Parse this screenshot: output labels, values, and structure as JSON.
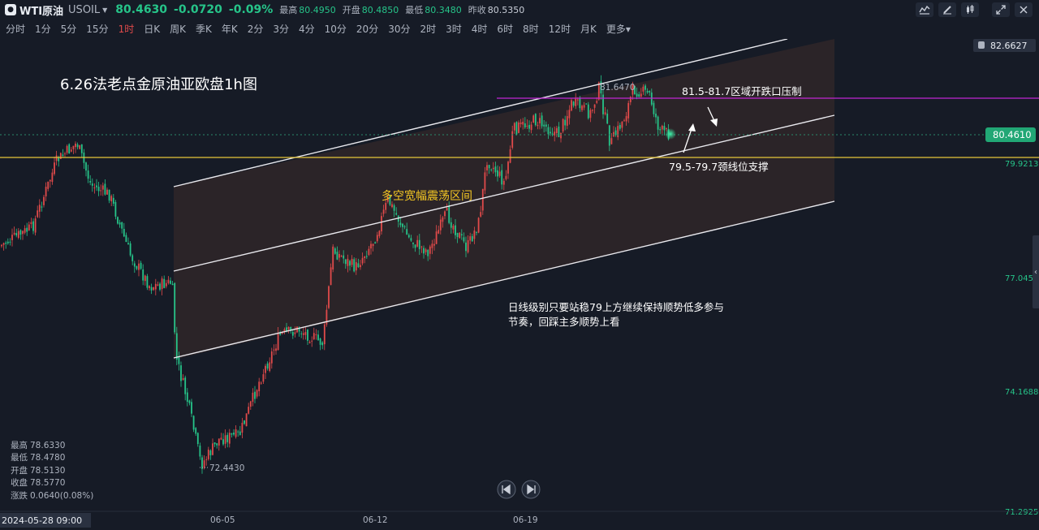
{
  "header": {
    "symbol": "WTI原油",
    "code": "USOIL",
    "price": "80.4630",
    "change": "-0.0720",
    "change_pct": "-0.09%",
    "high_label": "最高",
    "high": "80.4950",
    "open_label": "开盘",
    "open": "80.4850",
    "low_label": "最低",
    "low": "80.3480",
    "prev_label": "昨收",
    "prev": "80.5350",
    "price_color": "#26c489"
  },
  "timeframes": [
    "分时",
    "1分",
    "5分",
    "15分",
    "1时",
    "日K",
    "周K",
    "季K",
    "年K",
    "2分",
    "3分",
    "4分",
    "10分",
    "20分",
    "30分",
    "2时",
    "3时",
    "4时",
    "6时",
    "8时",
    "12时",
    "月K",
    "更多"
  ],
  "active_timeframe": "1时",
  "price_axis": {
    "labels": [
      "82.6627",
      "79.9213",
      "77.0450",
      "74.1688",
      "71.2925"
    ],
    "current": "80.4610"
  },
  "time_axis": {
    "labels": [
      "06-05",
      "06-12",
      "06-19"
    ],
    "crosshair": "2024-05-28 09:00"
  },
  "annotations": {
    "title": "6.26法老点金原油亚欧盘1h图",
    "range_text": "多空宽幅震荡区间",
    "resistance_text": "81.5-81.7区域开跌口压制",
    "support_text": "79.5-79.7颈线位支撑",
    "note_line1": "日线级别只要站稳79上方继续保持顺势低多参与",
    "note_line2": "节奏，回踩主多顺势上看",
    "swing_high": "81.6470",
    "swing_low": "72.4430"
  },
  "ohlc": {
    "high_label": "最高",
    "high": "78.6330",
    "low_label": "最低",
    "low": "78.4780",
    "open_label": "开盘",
    "open": "78.5130",
    "close_label": "收盘",
    "close": "78.5770",
    "change_label": "涨跌",
    "change": "0.0640(0.08%)"
  },
  "colors": {
    "up": "#e04a4a",
    "down": "#26c489",
    "magenta_line": "#c026d3",
    "yellow_line": "#e6c63a",
    "channel_fill": "#3a2a2e"
  }
}
